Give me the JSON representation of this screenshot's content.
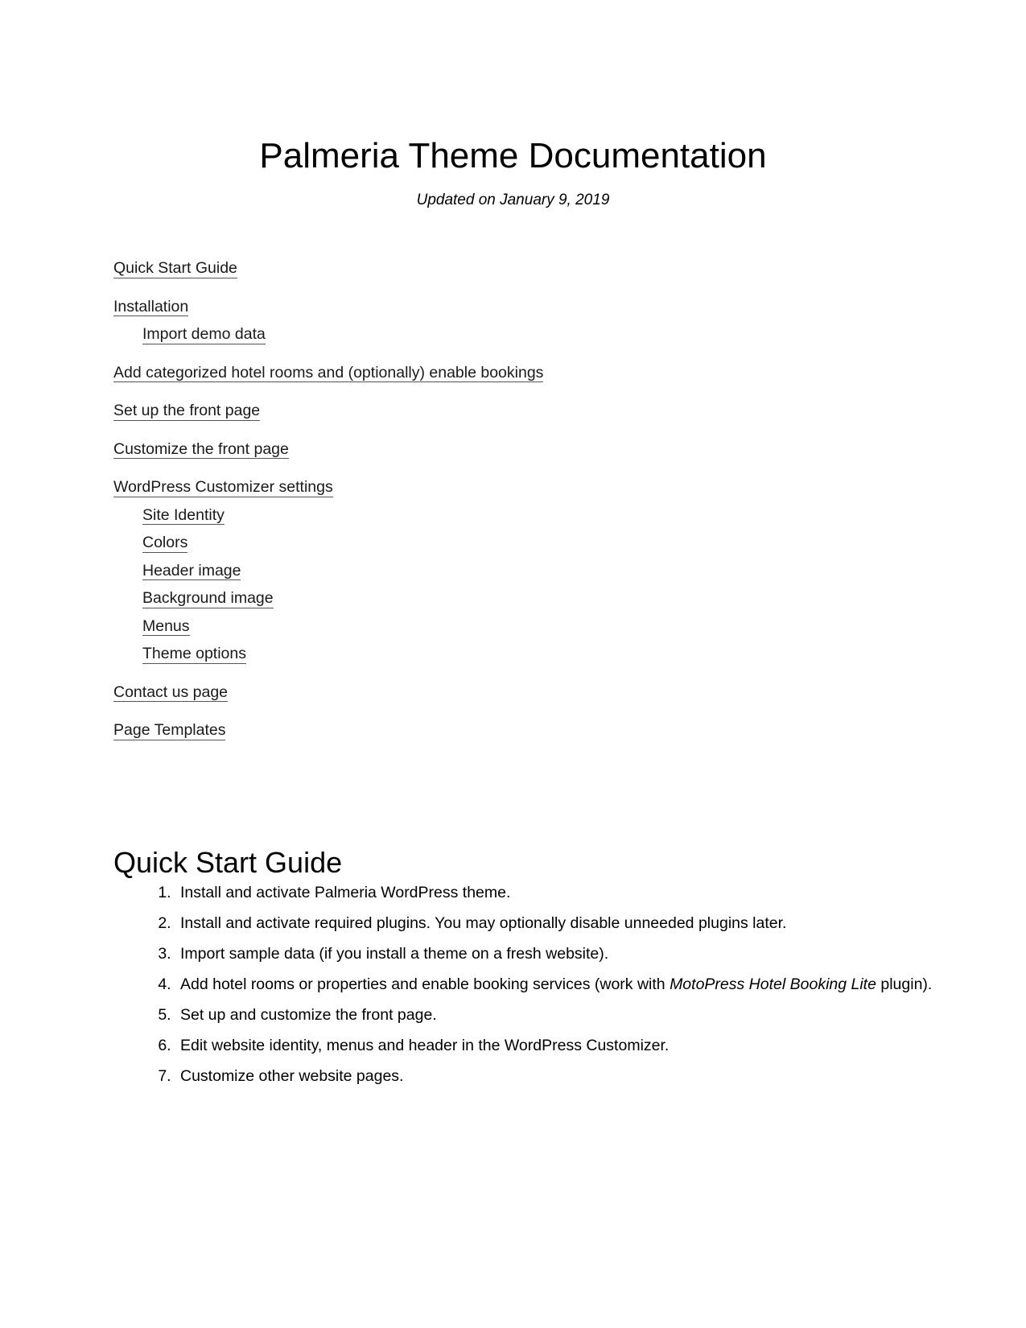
{
  "document": {
    "title": "Palmeria Theme Documentation",
    "subtitle": "Updated on January 9, 2019"
  },
  "toc": {
    "entries": [
      {
        "label": "Quick Start Guide",
        "level": 1
      },
      {
        "label": "Installation",
        "level": 1
      },
      {
        "label": "Import demo data",
        "level": 2
      },
      {
        "label": "Add categorized hotel rooms and (optionally) enable bookings",
        "level": 1
      },
      {
        "label": "Set up the front page",
        "level": 1
      },
      {
        "label": "Customize the front page",
        "level": 1
      },
      {
        "label": "WordPress Customizer settings",
        "level": 1
      },
      {
        "label": "Site Identity",
        "level": 2
      },
      {
        "label": "Colors",
        "level": 2
      },
      {
        "label": "Header image",
        "level": 2
      },
      {
        "label": "Background image",
        "level": 2
      },
      {
        "label": "Menus",
        "level": 2
      },
      {
        "label": "Theme options",
        "level": 2
      },
      {
        "label": "Contact us page",
        "level": 1
      },
      {
        "label": "Page Templates",
        "level": 1
      }
    ]
  },
  "quick_start": {
    "heading": "Quick Start Guide",
    "steps": [
      {
        "parts": [
          {
            "text": "Install and activate Palmeria WordPress theme.",
            "italic": false
          }
        ]
      },
      {
        "parts": [
          {
            "text": "Install and activate required plugins. You may optionally disable unneeded plugins later.",
            "italic": false
          }
        ]
      },
      {
        "parts": [
          {
            "text": "Import sample data (if you install a theme on a fresh website).",
            "italic": false
          }
        ]
      },
      {
        "parts": [
          {
            "text": "Add hotel rooms or properties and enable booking services (work with ",
            "italic": false
          },
          {
            "text": "MotoPress Hotel Booking Lite",
            "italic": true
          },
          {
            "text": " plugin).",
            "italic": false
          }
        ]
      },
      {
        "parts": [
          {
            "text": "Set up and customize the front page.",
            "italic": false
          }
        ]
      },
      {
        "parts": [
          {
            "text": "Edit website identity, menus and header in the WordPress Customizer.",
            "italic": false
          }
        ]
      },
      {
        "parts": [
          {
            "text": "Customize other website pages.",
            "italic": false
          }
        ]
      }
    ]
  },
  "colors": {
    "page_background": "#ffffff",
    "body_text": "#000000",
    "link_text": "#1a1a1a",
    "link_underline": "#555555"
  }
}
